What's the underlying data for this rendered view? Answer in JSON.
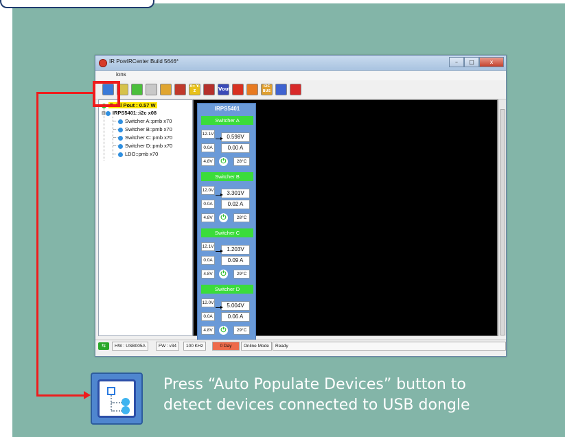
{
  "window": {
    "title": "IR PowIRCenter Build 5646*",
    "menu": "ions",
    "controls": {
      "minimize": "–",
      "maximize": "□",
      "close": "x"
    }
  },
  "toolbar": {
    "buttons": [
      {
        "name": "auto-populate-devices",
        "glyph": "",
        "color": "#3a7ad8"
      },
      {
        "name": "list-view",
        "glyph": "",
        "color": "#d6c24a"
      },
      {
        "name": "select-area",
        "glyph": "",
        "color": "#4bbf3b"
      },
      {
        "name": "new-file",
        "glyph": "",
        "color": "#c8c8c8"
      },
      {
        "name": "open-folder",
        "glyph": "",
        "color": "#e0a530"
      },
      {
        "name": "save",
        "glyph": "",
        "color": "#c0392b"
      },
      {
        "name": "equation",
        "glyph": "X= Y-Z",
        "color": "#e8c11a"
      },
      {
        "name": "chart",
        "glyph": "",
        "color": "#b5302c"
      },
      {
        "name": "vout",
        "glyph": "Vout",
        "color": "#3a4ab8"
      },
      {
        "name": "alert",
        "glyph": "",
        "color": "#d83020"
      },
      {
        "name": "fire",
        "glyph": "",
        "color": "#e87a20"
      },
      {
        "name": "i2c-bus",
        "glyph": "I2C BUS",
        "color": "#e0a030"
      },
      {
        "name": "pmbus",
        "glyph": "",
        "color": "#3f63d0"
      },
      {
        "name": "help",
        "glyph": "",
        "color": "#d82a2a"
      }
    ]
  },
  "tree": {
    "total": "Total Pout : 0.57 W",
    "device": "IRPS5401::i2c x08",
    "children": [
      "Switcher A::pmb x70",
      "Switcher B::pmb x70",
      "Switcher C::pmb x70",
      "Switcher D::pmb x70",
      "LDO::pmb x70"
    ]
  },
  "device_card": {
    "title": "IRPS5401",
    "switchers": [
      {
        "name": "Switcher A",
        "vin": "12.1V",
        "vout": "0.598V",
        "iin": "0.0A",
        "iout": "0.00 A",
        "vaux": "4.8V",
        "temp": "28°C"
      },
      {
        "name": "Switcher B",
        "vin": "12.0V",
        "vout": "3.301V",
        "iin": "0.0A",
        "iout": "0.02 A",
        "vaux": "4.8V",
        "temp": "28°C"
      },
      {
        "name": "Switcher C",
        "vin": "12.1V",
        "vout": "1.203V",
        "iin": "0.0A",
        "iout": "0.09 A",
        "vaux": "4.8V",
        "temp": "29°C"
      },
      {
        "name": "Switcher D",
        "vin": "12.0V",
        "vout": "5.004V",
        "iin": "0.0A",
        "iout": "0.06 A",
        "vaux": "4.8V",
        "temp": "29°C"
      }
    ]
  },
  "status_bar": {
    "hw": "HW : USB005A",
    "fw": "FW : v34",
    "freq": "100 KHz",
    "day": "0 Day",
    "mode": "Online Mode",
    "state": "Ready"
  },
  "caption": {
    "line1": "Press “Auto Populate Devices” button to",
    "line2": "detect devices connected to USB dongle"
  },
  "colors": {
    "background": "#83b5a8",
    "highlight": "#ee1c1c",
    "switcher_header": "#3bdc3b",
    "device_card": "#6a9ad8"
  }
}
